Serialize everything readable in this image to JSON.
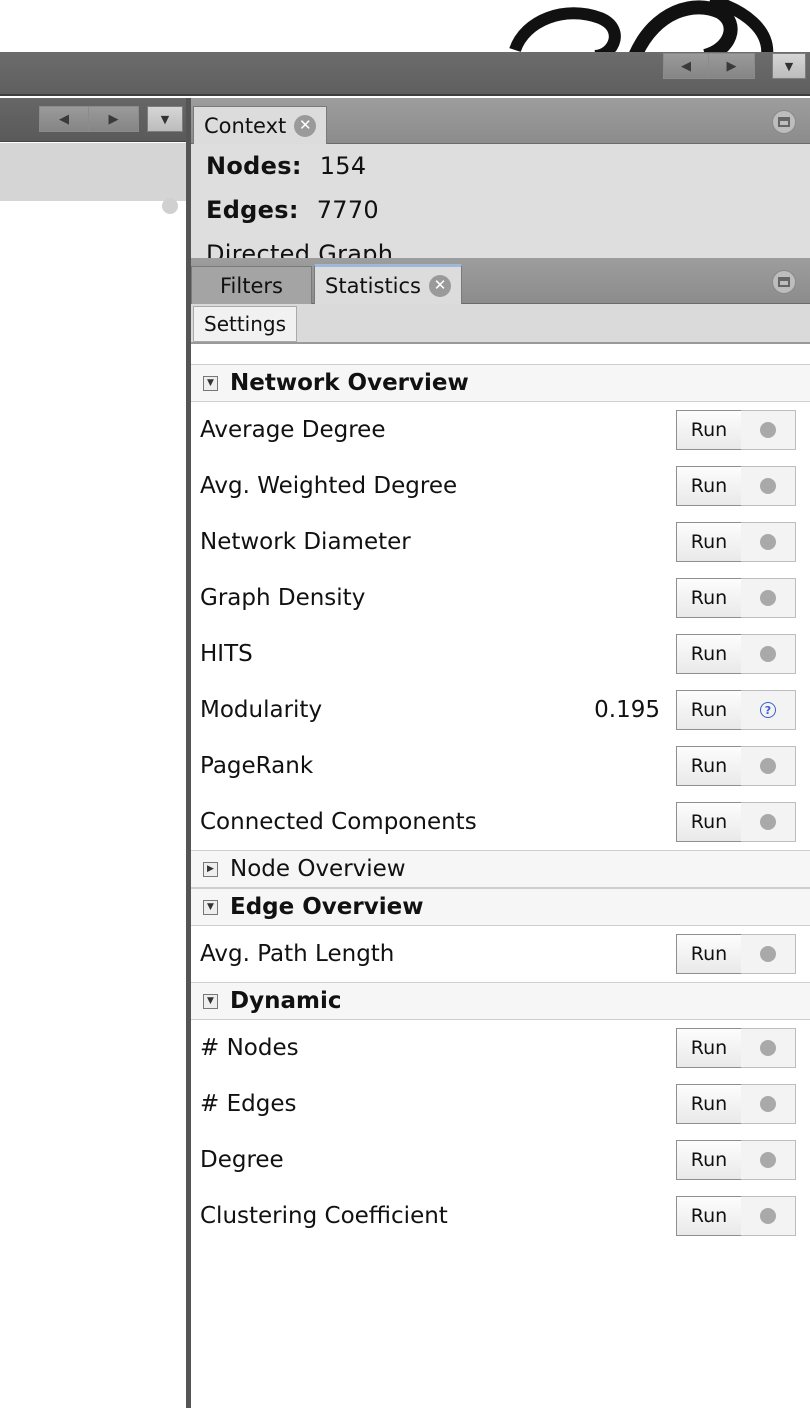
{
  "context_panel": {
    "tab_label": "Context",
    "nodes_label": "Nodes:",
    "nodes_value": "154",
    "edges_label": "Edges:",
    "edges_value": "7770",
    "graph_type": "Directed Graph"
  },
  "stats_panel": {
    "tabs": [
      {
        "label": "Filters"
      },
      {
        "label": "Statistics"
      }
    ],
    "settings_label": "Settings",
    "run_label": "Run",
    "sections": [
      {
        "title": "Network Overview",
        "expanded": true,
        "items": [
          {
            "label": "Average Degree",
            "value": ""
          },
          {
            "label": "Avg. Weighted Degree",
            "value": ""
          },
          {
            "label": "Network Diameter",
            "value": ""
          },
          {
            "label": "Graph Density",
            "value": ""
          },
          {
            "label": "HITS",
            "value": ""
          },
          {
            "label": "Modularity",
            "value": "0.195"
          },
          {
            "label": "PageRank",
            "value": ""
          },
          {
            "label": "Connected Components",
            "value": ""
          }
        ]
      },
      {
        "title": "Node Overview",
        "expanded": false,
        "items": []
      },
      {
        "title": "Edge Overview",
        "expanded": true,
        "items": [
          {
            "label": "Avg. Path Length",
            "value": ""
          }
        ]
      },
      {
        "title": "Dynamic",
        "expanded": true,
        "items": [
          {
            "label": "# Nodes",
            "value": ""
          },
          {
            "label": "# Edges",
            "value": ""
          },
          {
            "label": "Degree",
            "value": ""
          },
          {
            "label": "Clustering Coefficient",
            "value": ""
          }
        ]
      }
    ]
  },
  "icons": {
    "nav_left": "◀",
    "nav_right": "▶",
    "dropdown": "▼",
    "close": "✕"
  },
  "colors": {
    "toolbar": "#5f5f5f",
    "tab_active": "#dcdcdc",
    "help_link": "#3b5fd0"
  }
}
